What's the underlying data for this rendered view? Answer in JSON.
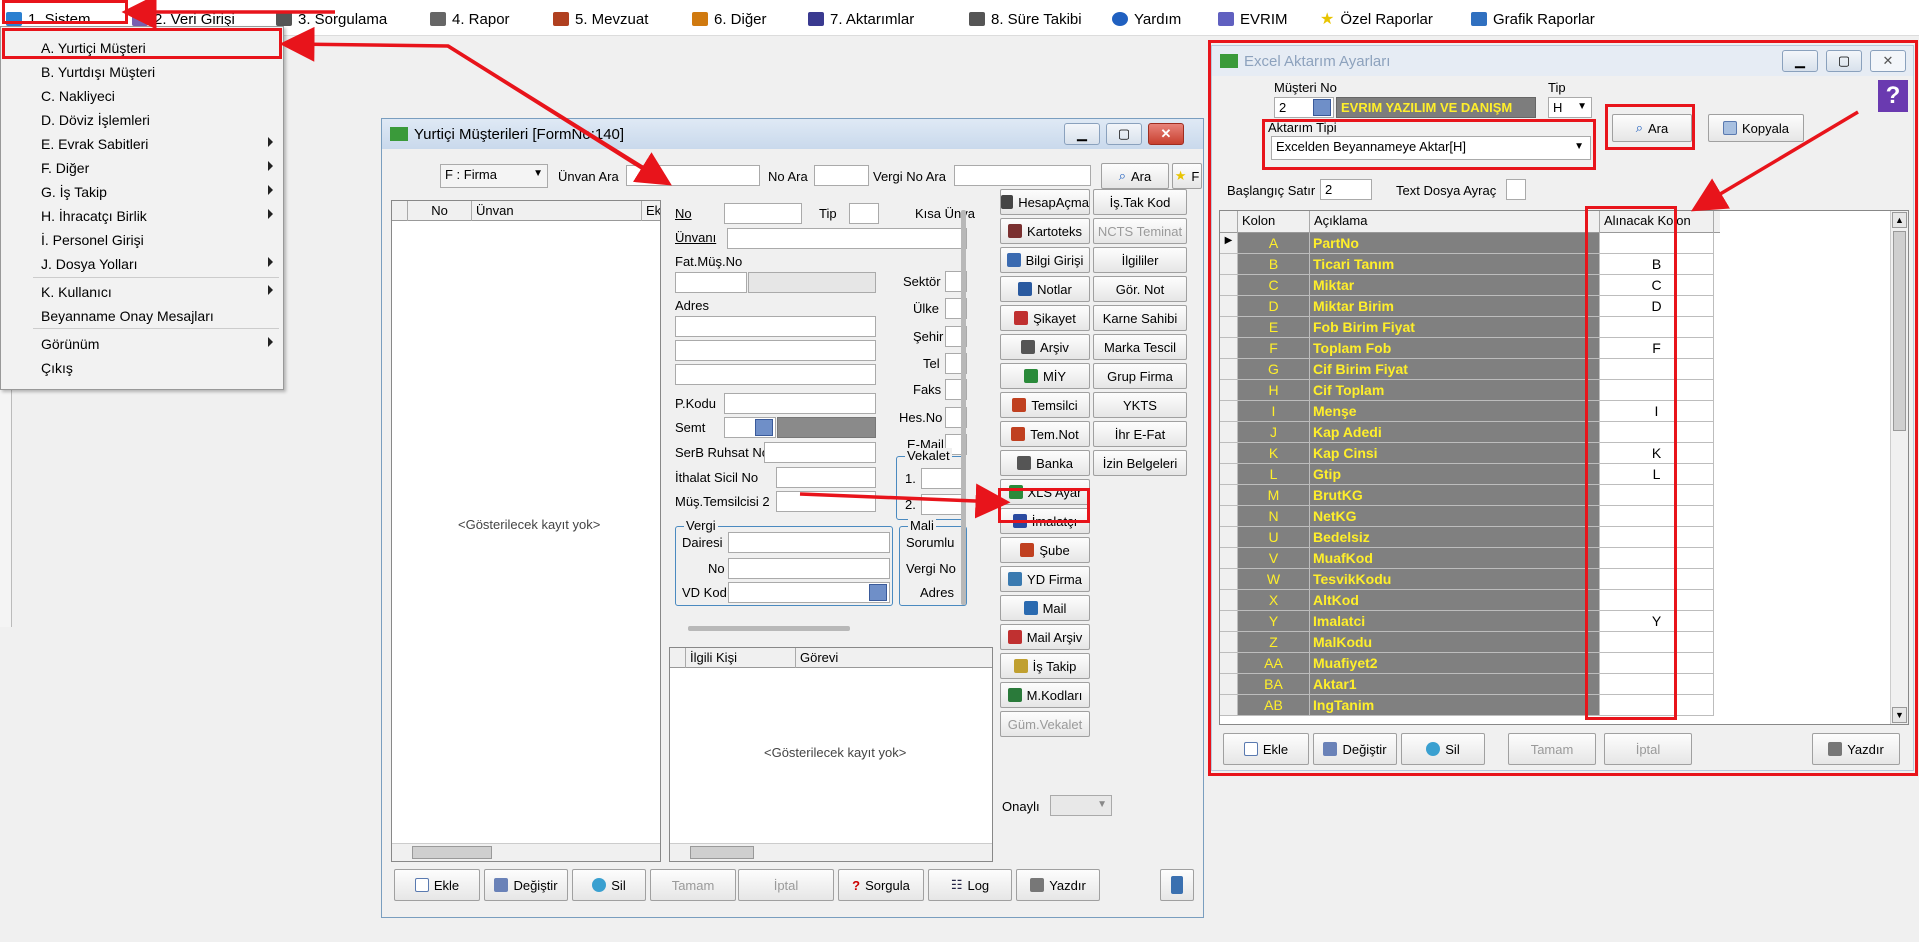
{
  "menubar": {
    "items": [
      {
        "label": "1.  Sistem",
        "icon": "app-icon",
        "color": "#2a7fd0"
      },
      {
        "label": "2.  Veri Girişi",
        "icon": "data-entry-icon",
        "color": "#7a5fb0"
      },
      {
        "label": "3.  Sorgulama",
        "icon": "query-icon",
        "color": "#555"
      },
      {
        "label": "4.  Rapor",
        "icon": "printer-icon",
        "color": "#666"
      },
      {
        "label": "5.  Mevzuat",
        "icon": "books-icon",
        "color": "#b04020"
      },
      {
        "label": "6.  Diğer",
        "icon": "other-icon",
        "color": "#d07a10"
      },
      {
        "label": "7.  Aktarımlar",
        "icon": "transfer-icon",
        "color": "#3a3a90"
      },
      {
        "label": "8. Süre Takibi",
        "icon": "calendar-icon",
        "color": "#555"
      },
      {
        "label": "Yardım",
        "icon": "help-icon",
        "color": "#2060c0"
      },
      {
        "label": "EVRIM",
        "icon": "evrim-icon",
        "color": "#6060c0"
      },
      {
        "label": "Özel Raporlar",
        "icon": "star-icon",
        "color": "#e8c400"
      },
      {
        "label": "Grafik Raporlar",
        "icon": "chart-icon",
        "color": "#3070c0"
      }
    ]
  },
  "sistem_menu": {
    "items": [
      {
        "label": "A.  Yurtiçi Müşteri",
        "sub": false
      },
      {
        "label": "B.  Yurtdışı Müşteri",
        "sub": false
      },
      {
        "label": "C.  Nakliyeci",
        "sub": false
      },
      {
        "label": "D.  Döviz İşlemleri",
        "sub": false
      },
      {
        "label": "E.  Evrak Sabitleri",
        "sub": true
      },
      {
        "label": "F.  Diğer",
        "sub": true
      },
      {
        "label": "G.  İş Takip",
        "sub": true
      },
      {
        "label": "H.  İhracatçı Birlik",
        "sub": true
      },
      {
        "label": "İ.   Personel Girişi",
        "sub": false
      },
      {
        "label": "J.  Dosya Yolları",
        "sub": true
      },
      {
        "label": "K.  Kullanıcı",
        "sub": true
      },
      {
        "label": "Beyanname Onay Mesajları",
        "sub": false
      },
      {
        "label": "Görünüm",
        "sub": true
      },
      {
        "label": "Çıkış",
        "sub": false
      }
    ]
  },
  "yurtici": {
    "title": "Yurtiçi Müşterileri [FormNo:140]",
    "firma_select": "F : Firma",
    "unvan_ara": "Ünvan Ara",
    "no_ara": "No Ara",
    "vergi_no_ara": "Vergi No Ara",
    "ara": "Ara",
    "f_label": "F",
    "grid_cols": [
      "No",
      "Ünvan",
      "Ek"
    ],
    "empty": "<Gösterilecek kayıt yok>",
    "form": {
      "no": "No",
      "tip": "Tip",
      "kisa_unvan": "Kısa Ünva",
      "unvani": "Ünvanı",
      "fat_mus_no": "Fat.Müş.No",
      "adres": "Adres",
      "sektor": "Sektör",
      "ulke": "Ülke",
      "sehir": "Şehir",
      "tel": "Tel",
      "faks": "Faks",
      "p_kodu": "P.Kodu",
      "semt": "Semt",
      "hes_no": "Hes.No",
      "e_mail": "E-Mail",
      "serb": "SerB Ruhsat No",
      "ithalat": "İthalat Sicil No",
      "mus_tem": "Müş.Temsilcisi 2",
      "vekalet": "Vekalet",
      "v1": "1.",
      "v2": "2.",
      "vergi": "Vergi",
      "dairesi": "Dairesi",
      "vno": "No",
      "vd_kod": "VD Kod",
      "mali": "Mali",
      "sorumlu": "Sorumlu",
      "vergi_no": "Vergi No",
      "adres2": "Adres"
    },
    "contact_cols": [
      "İlgili Kişi",
      "Görevi"
    ],
    "side_left": [
      "HesapAçma",
      "Kartoteks",
      "Bilgi Girişi",
      "Notlar",
      "Şikayet",
      "Arşiv",
      "MİY",
      "Temsilci",
      "Tem.Not",
      "Banka",
      "XLS Ayar",
      "İmalatçı",
      "Şube",
      "YD Firma",
      "Mail",
      "Mail Arşiv",
      "İş Takip",
      "M.Kodları",
      "Güm.Vekalet"
    ],
    "side_right": [
      "İş.Tak Kod",
      "NCTS Teminat",
      "İlgililer",
      "Gör. Not",
      "Karne Sahibi",
      "Marka Tescil",
      "Grup Firma",
      "YKTS",
      "İhr E-Fat",
      "İzin Belgeleri"
    ],
    "onayli": "Onaylı",
    "bottom": [
      "Ekle",
      "Değiştir",
      "Sil",
      "Tamam",
      "İptal",
      "Sorgula",
      "Log",
      "Yazdır"
    ]
  },
  "excel": {
    "title": "Excel Aktarım Ayarları",
    "musteri_no_label": "Müşteri No",
    "musteri_no": "2",
    "musteri_name": "EVRIM YAZILIM VE DANIŞM",
    "tip_label": "Tip",
    "tip": "H",
    "aktarim_tipi_label": "Aktarım Tipi",
    "aktarim_tipi": "Excelden Beyannameye Aktar[H]",
    "ara": "Ara",
    "kopyala": "Kopyala",
    "baslangic_label": "Başlangıç Satır",
    "baslangic": "2",
    "text_dosya": "Text Dosya Ayraç",
    "cols": [
      "Kolon",
      "Açıklama",
      "Alınacak Kolon"
    ],
    "rows": [
      {
        "k": "A",
        "a": "PartNo",
        "al": ""
      },
      {
        "k": "B",
        "a": "Ticari Tanım",
        "al": "B"
      },
      {
        "k": "C",
        "a": "Miktar",
        "al": "C"
      },
      {
        "k": "D",
        "a": "Miktar Birim",
        "al": "D"
      },
      {
        "k": "E",
        "a": "Fob Birim Fiyat",
        "al": ""
      },
      {
        "k": "F",
        "a": "Toplam Fob",
        "al": "F"
      },
      {
        "k": "G",
        "a": "Cif Birim Fiyat",
        "al": ""
      },
      {
        "k": "H",
        "a": "Cif Toplam",
        "al": ""
      },
      {
        "k": "I",
        "a": "Menşe",
        "al": "I"
      },
      {
        "k": "J",
        "a": "Kap Adedi",
        "al": ""
      },
      {
        "k": "K",
        "a": "Kap Cinsi",
        "al": "K"
      },
      {
        "k": "L",
        "a": "Gtip",
        "al": "L"
      },
      {
        "k": "M",
        "a": "BrutKG",
        "al": ""
      },
      {
        "k": "N",
        "a": "NetKG",
        "al": ""
      },
      {
        "k": "U",
        "a": "Bedelsiz",
        "al": ""
      },
      {
        "k": "V",
        "a": "MuafKod",
        "al": ""
      },
      {
        "k": "W",
        "a": "TesvikKodu",
        "al": ""
      },
      {
        "k": "X",
        "a": "AltKod",
        "al": ""
      },
      {
        "k": "Y",
        "a": "Imalatci",
        "al": "Y"
      },
      {
        "k": "Z",
        "a": "MalKodu",
        "al": ""
      },
      {
        "k": "AA",
        "a": "Muafiyet2",
        "al": ""
      },
      {
        "k": "BA",
        "a": "Aktar1",
        "al": ""
      },
      {
        "k": "AB",
        "a": "IngTanim",
        "al": ""
      }
    ],
    "bottom": [
      "Ekle",
      "Değiştir",
      "Sil",
      "Tamam",
      "İptal",
      "Yazdır"
    ]
  },
  "colors": {
    "highlight": "#e8141b",
    "grid_bg": "#808080",
    "grid_text": "#ffef2a"
  }
}
